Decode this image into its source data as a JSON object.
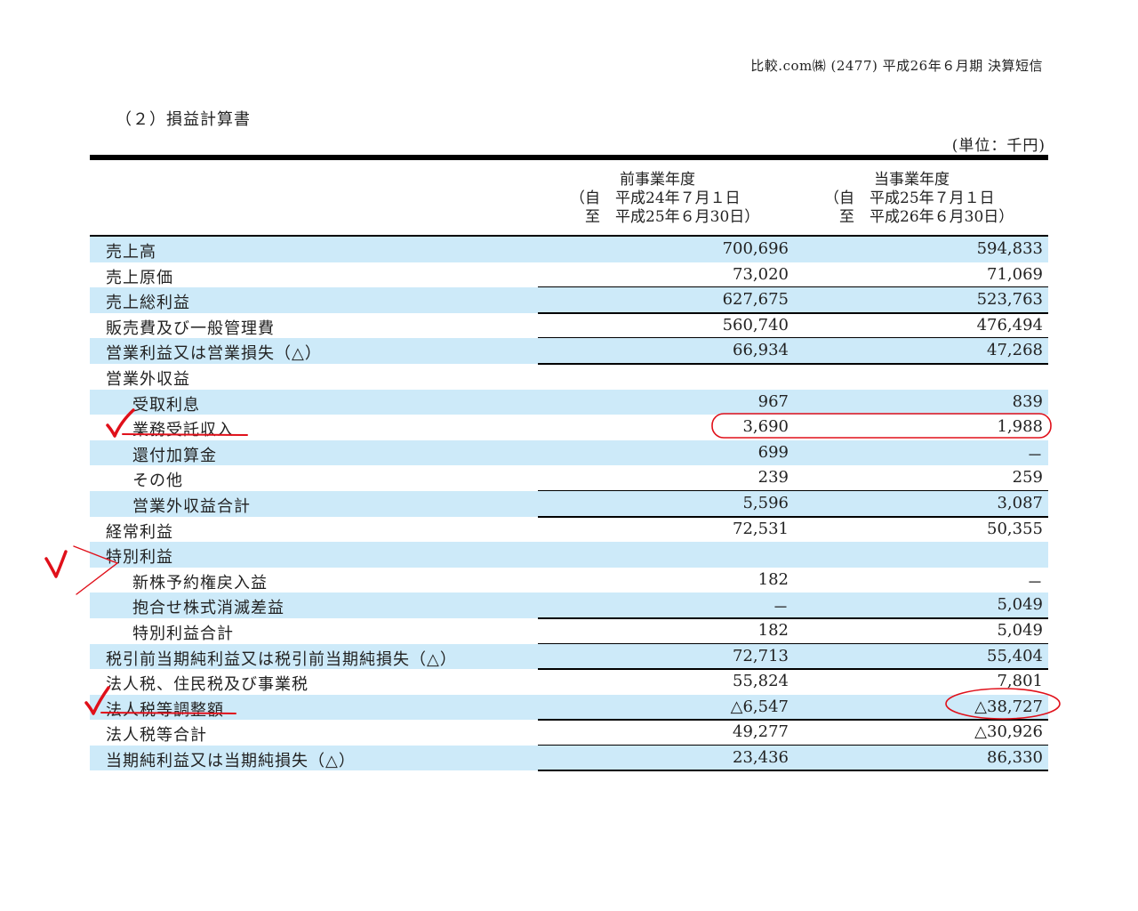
{
  "header": {
    "company": "比較.com㈱ (2477) 平成26年６月期 決算短信",
    "section_title": "（２）損益計算書",
    "unit": "(単位：千円)"
  },
  "columns": [
    {
      "title": "前事業年度",
      "line1": "（自　平成24年７月１日",
      "line2": "　至　平成25年６月30日）"
    },
    {
      "title": "当事業年度",
      "line1": "（自　平成25年７月１日",
      "line2": "　至　平成26年６月30日）"
    }
  ],
  "rows": [
    {
      "label": "売上高",
      "prev": "700,696",
      "curr": "594,833"
    },
    {
      "label": "売上原価",
      "prev": "73,020",
      "curr": "71,069"
    },
    {
      "label": "売上総利益",
      "prev": "627,675",
      "curr": "523,763"
    },
    {
      "label": "販売費及び一般管理費",
      "prev": "560,740",
      "curr": "476,494"
    },
    {
      "label": "営業利益又は営業損失（△）",
      "prev": "66,934",
      "curr": "47,268"
    },
    {
      "label": "営業外収益",
      "prev": "",
      "curr": ""
    },
    {
      "label": "受取利息",
      "prev": "967",
      "curr": "839"
    },
    {
      "label": "業務受託収入",
      "prev": "3,690",
      "curr": "1,988"
    },
    {
      "label": "還付加算金",
      "prev": "699",
      "curr": "－"
    },
    {
      "label": "その他",
      "prev": "239",
      "curr": "259"
    },
    {
      "label": "営業外収益合計",
      "prev": "5,596",
      "curr": "3,087"
    },
    {
      "label": "経常利益",
      "prev": "72,531",
      "curr": "50,355"
    },
    {
      "label": "特別利益",
      "prev": "",
      "curr": ""
    },
    {
      "label": "新株予約権戻入益",
      "prev": "182",
      "curr": "－"
    },
    {
      "label": "抱合せ株式消滅差益",
      "prev": "－",
      "curr": "5,049"
    },
    {
      "label": "特別利益合計",
      "prev": "182",
      "curr": "5,049"
    },
    {
      "label": "税引前当期純利益又は税引前当期純損失（△）",
      "prev": "72,713",
      "curr": "55,404"
    },
    {
      "label": "法人税、住民税及び事業税",
      "prev": "55,824",
      "curr": "7,801"
    },
    {
      "label": "法人税等調整額",
      "prev": "△6,547",
      "curr": "△38,727"
    },
    {
      "label": "法人税等合計",
      "prev": "49,277",
      "curr": "△30,926"
    },
    {
      "label": "当期純利益又は当期純損失（△）",
      "prev": "23,436",
      "curr": "86,330"
    }
  ],
  "colors": {
    "row_shade": "#cdeaf9",
    "annotation": "#e0101a"
  }
}
